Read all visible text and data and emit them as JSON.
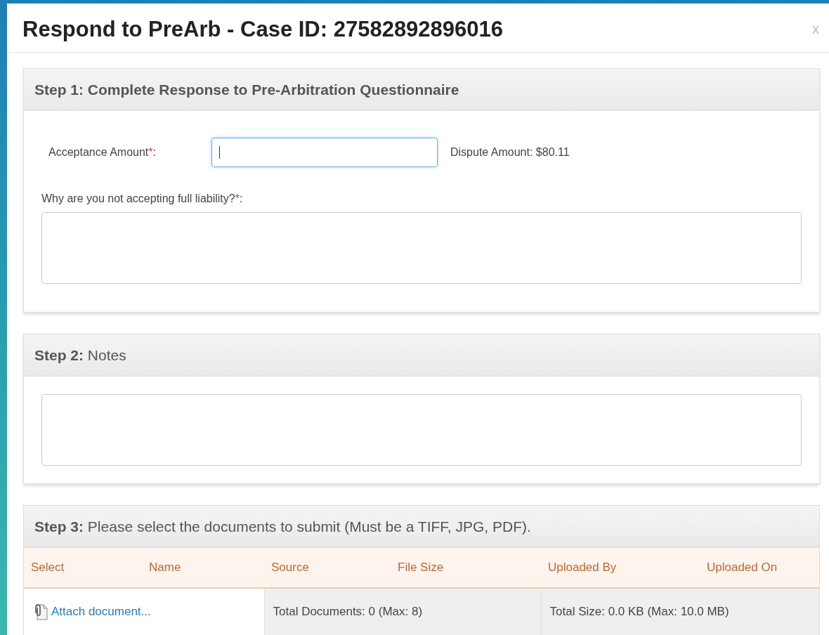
{
  "dialog": {
    "title": "Respond to PreArb - Case ID: 27582892896016",
    "close": "x"
  },
  "step1": {
    "heading": "Step 1: Complete Response to Pre-Arbitration Questionnaire",
    "heading_bold": true,
    "acceptance": {
      "label": "Acceptance Amount",
      "required_mark": "*",
      "separator": ":",
      "focused": true
    },
    "dispute_amount": "Dispute Amount: $80.11",
    "question": {
      "label": "Why are you not accepting full liability?",
      "required_mark": "*",
      "separator": ":",
      "focused": false
    }
  },
  "step2": {
    "heading": "**Step 2:** Notes",
    "heading_bold": false,
    "notes": {
      "focused": false
    }
  },
  "step3": {
    "heading": "**Step 3:** Please select the documents to submit (Must be a TIFF, JPG, PDF).",
    "heading_bold": false,
    "table": {
      "columns": [
        "Select",
        "Name",
        "Source",
        "File Size",
        "Uploaded By",
        "Uploaded On"
      ],
      "footer": [
        {
          "kind": "link",
          "text": "Attach document..."
        },
        {
          "kind": "text",
          "text": "Total Documents: 0 (Max: 8)"
        },
        {
          "kind": "text",
          "text": "Total Size: 0.0 KB (Max: 10.0 MB)"
        }
      ]
    }
  }
}
